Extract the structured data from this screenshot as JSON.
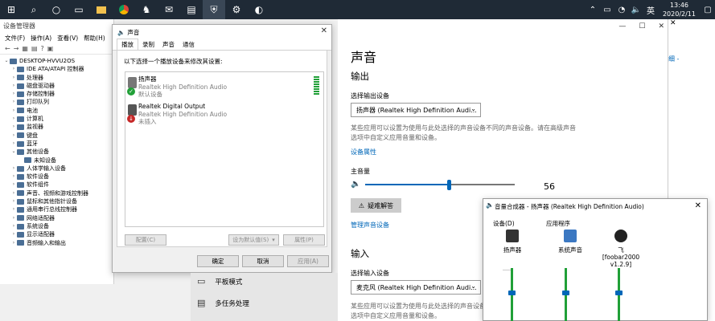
{
  "taskbar": {
    "icons": [
      "windows-icon",
      "search-icon",
      "cortana-icon",
      "task-view-icon",
      "file-explorer-icon",
      "chrome-icon",
      "foobar-icon",
      "mail-icon",
      "app-icon",
      "shield-icon",
      "settings-icon",
      "app2-icon"
    ],
    "tray": {
      "time": "13:46",
      "date": "2020/2/11",
      "ime": "英"
    }
  },
  "device_manager": {
    "title": "设备管理器",
    "menu": [
      "文件(F)",
      "操作(A)",
      "查看(V)",
      "帮助(H)"
    ],
    "tree": [
      {
        "label": "DESKTOP-HVVU2OS",
        "level": 0,
        "expanded": true
      },
      {
        "label": "IDE ATA/ATAPI 控制器",
        "level": 1
      },
      {
        "label": "处理器",
        "level": 1
      },
      {
        "label": "磁盘驱动器",
        "level": 1
      },
      {
        "label": "存储控制器",
        "level": 1
      },
      {
        "label": "打印队列",
        "level": 1
      },
      {
        "label": "电池",
        "level": 1
      },
      {
        "label": "计算机",
        "level": 1
      },
      {
        "label": "监视器",
        "level": 1
      },
      {
        "label": "键盘",
        "level": 1
      },
      {
        "label": "蓝牙",
        "level": 1
      },
      {
        "label": "其他设备",
        "level": 1,
        "expanded": true
      },
      {
        "label": "未知设备",
        "level": 2
      },
      {
        "label": "人体学输入设备",
        "level": 1
      },
      {
        "label": "软件设备",
        "level": 1
      },
      {
        "label": "软件组件",
        "level": 1
      },
      {
        "label": "声音、视频和游戏控制器",
        "level": 1
      },
      {
        "label": "鼠标和其他指针设备",
        "level": 1
      },
      {
        "label": "通用串行总线控制器",
        "level": 1
      },
      {
        "label": "网络适配器",
        "level": 1
      },
      {
        "label": "系统设备",
        "level": 1
      },
      {
        "label": "显示适配器",
        "level": 1
      },
      {
        "label": "音频输入和输出",
        "level": 1
      }
    ]
  },
  "sound_dialog": {
    "title": "声音",
    "tabs": [
      "播放",
      "录制",
      "声音",
      "通信"
    ],
    "active_tab": "播放",
    "instruction": "以下选择一个播放设备来修改其设置:",
    "devices": [
      {
        "name": "扬声器",
        "driver": "Realtek High Definition Audio",
        "status": "默认设备",
        "state": "default"
      },
      {
        "name": "Realtek Digital Output",
        "driver": "Realtek High Definition Audio",
        "status": "未插入",
        "state": "unplugged"
      }
    ],
    "buttons": {
      "configure": "配置(C)",
      "set_default": "设为默认值(S)",
      "properties": "属性(P)",
      "ok": "确定",
      "cancel": "取消",
      "apply": "应用(A)"
    }
  },
  "settings": {
    "title": "声音",
    "output": {
      "heading": "输出",
      "select_label": "选择输出设备",
      "device": "扬声器 (Realtek High Definition Audi...",
      "note": "某些应用可以设置为使用与此处选择的声音设备不同的声音设备。请在高级声音选项中自定义应用音量和设备。",
      "properties_link": "设备属性",
      "volume_label": "主音量",
      "volume": 56,
      "troubleshoot": "疑难解答",
      "manage_link": "管理声音设备"
    },
    "input": {
      "heading": "输入",
      "select_label": "选择输入设备",
      "device": "麦克风 (Realtek High Definition Audi...",
      "note": "某些应用可以设置为使用与此处选择的声音设备不同的声音设备。请在高级声音选项中自定义应用音量和设备。"
    },
    "nav": [
      {
        "label": "平板模式",
        "icon": "tablet-mode-icon"
      },
      {
        "label": "多任务处理",
        "icon": "multitasking-icon"
      }
    ]
  },
  "right_strip": {
    "link": "细 -"
  },
  "mixer": {
    "title": "音量合成器 - 扬声器 (Realtek High Definition Audio)",
    "device_header": "设备(D)",
    "apps_header": "应用程序",
    "columns": [
      {
        "name": "扬声器",
        "icon": "speaker-icon"
      },
      {
        "name": "系统声音",
        "icon": "system-sounds-icon"
      },
      {
        "name": "飞 [foobar2000 v1.2.9]",
        "icon": "foobar-icon"
      }
    ]
  }
}
